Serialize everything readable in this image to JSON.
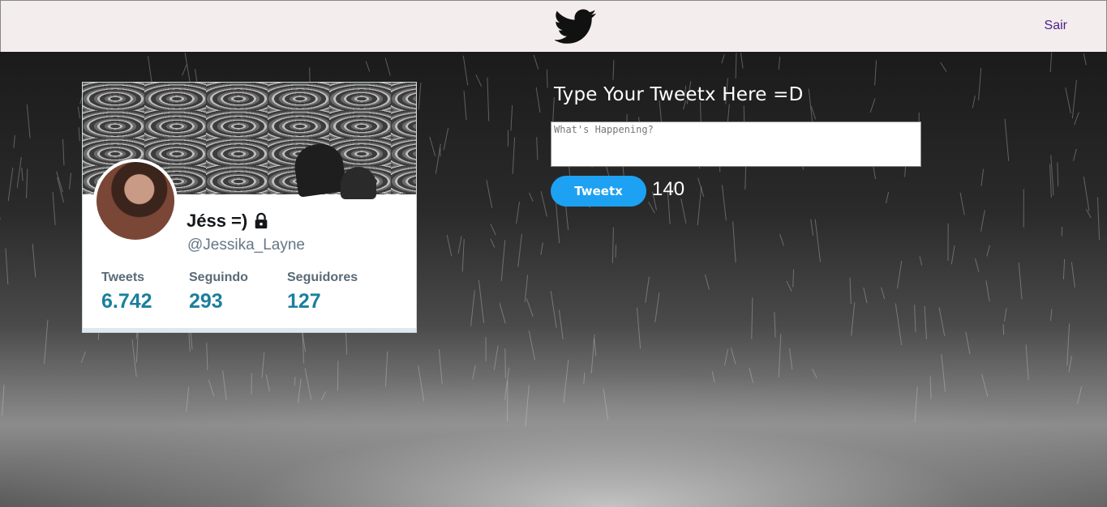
{
  "header": {
    "logo_icon": "twitter-bird-icon",
    "logout_label": "Sair"
  },
  "profile": {
    "name": "Jéss =)",
    "lock_icon": "lock-icon",
    "handle": "@Jessika_Layne",
    "stats": [
      {
        "label": "Tweets",
        "value": "6.742"
      },
      {
        "label": "Seguindo",
        "value": "293"
      },
      {
        "label": "Seguidores",
        "value": "127"
      }
    ]
  },
  "compose": {
    "title": "Type Your Tweetx Here =D",
    "placeholder": "What's Happening?",
    "button_label": "Tweetx",
    "char_count": "140"
  },
  "colors": {
    "brand": "#1da1f2",
    "stat_number": "#1b7f9e",
    "topbar": "#f3eded",
    "link": "#4b1f8a"
  }
}
